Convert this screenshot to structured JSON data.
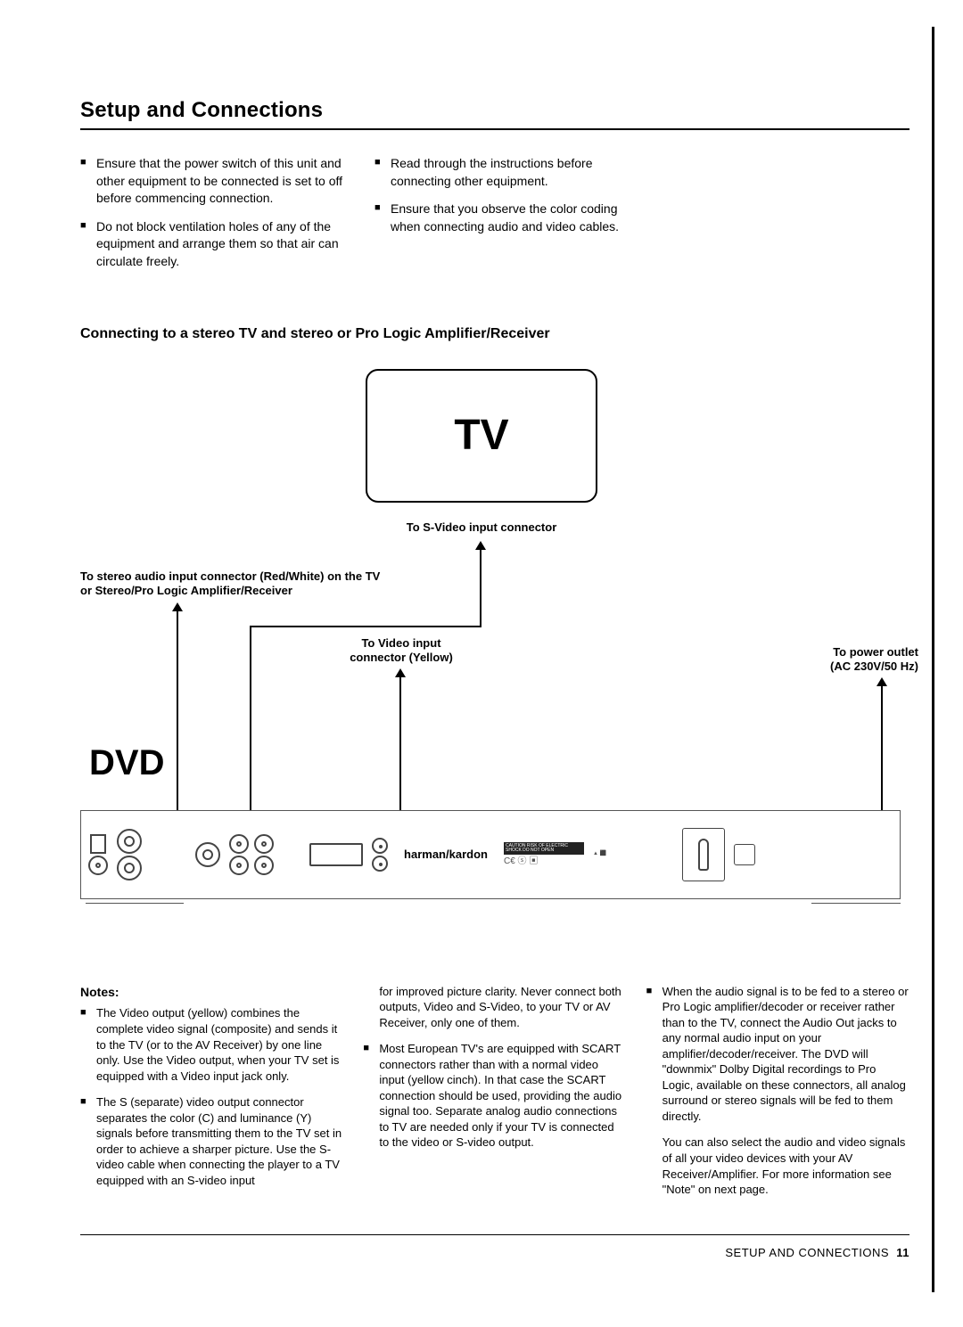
{
  "page_title": "Setup and Connections",
  "intro": {
    "col1": [
      "Ensure that the power switch of this unit and other equipment to be connected is set to off before commencing connection.",
      "Do not block ventilation holes of any of the equipment and arrange them so that air can circulate freely."
    ],
    "col2": [
      "Read through the instructions before connecting other equipment.",
      "Ensure that you observe the color coding when connecting audio and video cables."
    ]
  },
  "section_subtitle": "Connecting to a stereo TV and stereo or Pro Logic Amplifier/Receiver",
  "diagram": {
    "tv_label": "TV",
    "svideo_label": "To S-Video input connector",
    "audio_label": "To stereo audio input connector (Red/White) on the TV or Stereo/Pro Logic Amplifier/Receiver",
    "video_label_line1": "To Video input",
    "video_label_line2": "connector (Yellow)",
    "power_label_line1": "To power outlet",
    "power_label_line2": "(AC 230V/50 Hz)",
    "dvd_label": "DVD",
    "panel_brand": "harman/kardon"
  },
  "notes": {
    "heading": "Notes:",
    "col1": [
      "The Video output (yellow) combines the complete video signal (composite) and sends it to the TV (or to the AV Receiver) by one line only. Use the Video output, when your TV set is equipped with a Video input jack only.",
      "The S (separate) video output connector separates the color (C) and luminance (Y) signals before transmitting them to the TV set in order to achieve a sharper picture. Use the S-video cable when connecting the player to a TV equipped with an S-video input"
    ],
    "col2_lead": "for improved picture clarity. Never connect both outputs, Video and S-Video, to your TV or AV Receiver, only one of them.",
    "col2_bullet": "Most European TV's are equipped with SCART connectors rather than with a normal video input (yellow cinch). In that case the SCART connection should be used, providing the audio signal too. Separate analog audio connections to TV are needed only if your TV is connected to the video or S-video output.",
    "col3_bullet": "When the audio signal is to be fed to a stereo or Pro Logic amplifier/decoder or receiver rather than to the TV, connect the Audio Out jacks to any normal audio input on your amplifier/decoder/receiver. The DVD will \"downmix\" Dolby Digital recordings to Pro Logic, available on these connectors, all analog surround or stereo signals will be fed to them directly.",
    "col3_extra": "You can also select the audio and video signals of all your video devices with your AV Receiver/Amplifier. For more information see \"Note\" on next page."
  },
  "footer": {
    "text": "SETUP AND CONNECTIONS",
    "page_number": "11"
  }
}
